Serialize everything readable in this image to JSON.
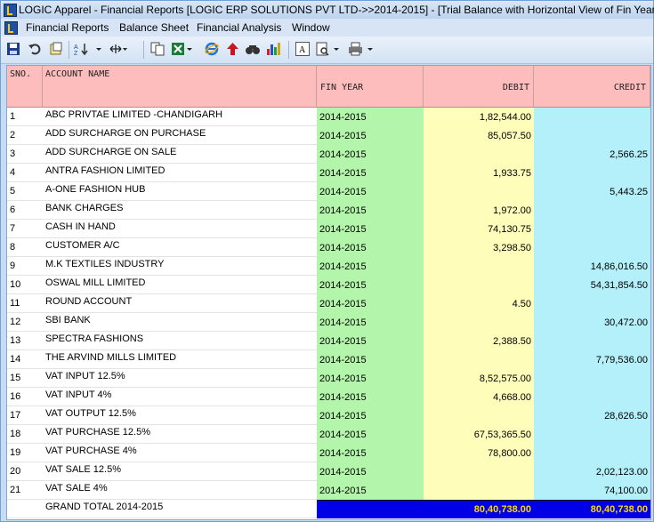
{
  "window": {
    "title": "LOGIC Apparel - Financial Reports  [LOGIC ERP SOLUTIONS PVT LTD->>2014-2015] - [Trial Balance with Horizontal View of Fin Years]"
  },
  "menu": [
    "Financial Reports",
    "Balance Sheet",
    "Financial Analysis",
    "Window"
  ],
  "toolbar": {
    "icons": [
      "save-icon",
      "undo-icon",
      "export-icon",
      "sort-icon",
      "dropdown-icon",
      "column-width-icon",
      "copy-icon",
      "excel-icon",
      "ie-icon",
      "up-arrow-icon",
      "find-icon",
      "chart-icon",
      "font-icon",
      "print-preview-icon",
      "print-icon"
    ]
  },
  "grid": {
    "headers": {
      "sno": "SNO.",
      "name": "ACCOUNT NAME",
      "fy": "FIN YEAR",
      "debit": "DEBIT",
      "credit": "CREDIT"
    },
    "rows": [
      {
        "sno": "1",
        "name": "ABC PRIVTAE LIMITED          -CHANDIGARH",
        "fy": "2014-2015",
        "debit": "1,82,544.00",
        "credit": ""
      },
      {
        "sno": "2",
        "name": "ADD SURCHARGE ON PURCHASE",
        "fy": "2014-2015",
        "debit": "85,057.50",
        "credit": ""
      },
      {
        "sno": "3",
        "name": "ADD SURCHARGE ON SALE",
        "fy": "2014-2015",
        "debit": "",
        "credit": "2,566.25"
      },
      {
        "sno": "4",
        "name": "ANTRA FASHION LIMITED",
        "fy": "2014-2015",
        "debit": "1,933.75",
        "credit": ""
      },
      {
        "sno": "5",
        "name": "A-ONE FASHION HUB",
        "fy": "2014-2015",
        "debit": "",
        "credit": "5,443.25"
      },
      {
        "sno": "6",
        "name": "BANK CHARGES",
        "fy": "2014-2015",
        "debit": "1,972.00",
        "credit": ""
      },
      {
        "sno": "7",
        "name": "CASH IN HAND",
        "fy": "2014-2015",
        "debit": "74,130.75",
        "credit": ""
      },
      {
        "sno": "8",
        "name": "CUSTOMER A/C",
        "fy": "2014-2015",
        "debit": "3,298.50",
        "credit": ""
      },
      {
        "sno": "9",
        "name": "M.K TEXTILES INDUSTRY",
        "fy": "2014-2015",
        "debit": "",
        "credit": "14,86,016.50"
      },
      {
        "sno": "10",
        "name": "OSWAL MILL LIMITED",
        "fy": "2014-2015",
        "debit": "",
        "credit": "54,31,854.50"
      },
      {
        "sno": "11",
        "name": "ROUND ACCOUNT",
        "fy": "2014-2015",
        "debit": "4.50",
        "credit": ""
      },
      {
        "sno": "12",
        "name": "SBI BANK",
        "fy": "2014-2015",
        "debit": "",
        "credit": "30,472.00"
      },
      {
        "sno": "13",
        "name": "SPECTRA FASHIONS",
        "fy": "2014-2015",
        "debit": "2,388.50",
        "credit": ""
      },
      {
        "sno": "14",
        "name": "THE ARVIND MILLS LIMITED",
        "fy": "2014-2015",
        "debit": "",
        "credit": "7,79,536.00"
      },
      {
        "sno": "15",
        "name": "VAT INPUT 12.5%",
        "fy": "2014-2015",
        "debit": "8,52,575.00",
        "credit": ""
      },
      {
        "sno": "16",
        "name": "VAT INPUT 4%",
        "fy": "2014-2015",
        "debit": "4,668.00",
        "credit": ""
      },
      {
        "sno": "17",
        "name": "VAT OUTPUT 12.5%",
        "fy": "2014-2015",
        "debit": "",
        "credit": "28,626.50"
      },
      {
        "sno": "18",
        "name": "VAT PURCHASE 12.5%",
        "fy": "2014-2015",
        "debit": "67,53,365.50",
        "credit": ""
      },
      {
        "sno": "19",
        "name": "VAT PURCHASE 4%",
        "fy": "2014-2015",
        "debit": "78,800.00",
        "credit": ""
      },
      {
        "sno": "20",
        "name": "VAT SALE 12.5%",
        "fy": "2014-2015",
        "debit": "",
        "credit": "2,02,123.00"
      },
      {
        "sno": "21",
        "name": "VAT SALE 4%",
        "fy": "2014-2015",
        "debit": "",
        "credit": "74,100.00"
      }
    ],
    "total": {
      "label": "GRAND TOTAL 2014-2015",
      "debit": "80,40,738.00",
      "credit": "80,40,738.00"
    }
  }
}
